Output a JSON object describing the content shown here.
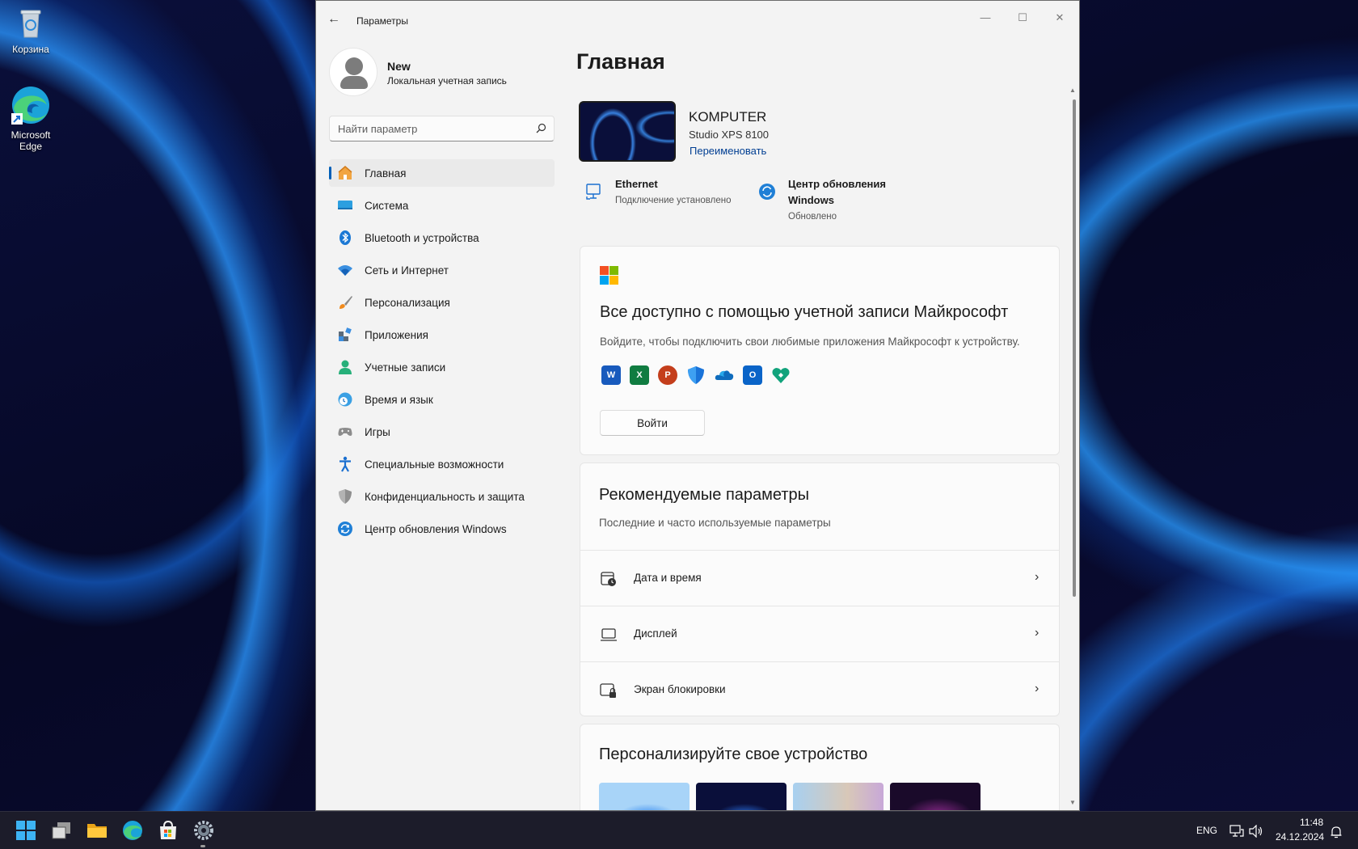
{
  "desktop": {
    "icons": [
      {
        "label": "Корзина"
      },
      {
        "label": "Microsoft Edge"
      }
    ]
  },
  "window": {
    "title": "Параметры",
    "controls": {
      "minimize": "—",
      "maximize": "☐",
      "close": "✕"
    }
  },
  "profile": {
    "name": "New",
    "account_type": "Локальная учетная запись"
  },
  "search": {
    "placeholder": "Найти параметр"
  },
  "nav": {
    "items": [
      {
        "label": "Главная",
        "icon": "home-icon",
        "active": true
      },
      {
        "label": "Система",
        "icon": "system-icon"
      },
      {
        "label": "Bluetooth и устройства",
        "icon": "bluetooth-icon"
      },
      {
        "label": "Сеть и Интернет",
        "icon": "wifi-icon"
      },
      {
        "label": "Персонализация",
        "icon": "brush-icon"
      },
      {
        "label": "Приложения",
        "icon": "apps-icon"
      },
      {
        "label": "Учетные записи",
        "icon": "accounts-icon"
      },
      {
        "label": "Время и язык",
        "icon": "time-language-icon"
      },
      {
        "label": "Игры",
        "icon": "gamepad-icon"
      },
      {
        "label": "Специальные возможности",
        "icon": "accessibility-icon"
      },
      {
        "label": "Конфиденциальность и защита",
        "icon": "shield-icon"
      },
      {
        "label": "Центр обновления Windows",
        "icon": "windows-update-icon"
      }
    ]
  },
  "main": {
    "title": "Главная",
    "pc": {
      "name": "KOMPUTER",
      "model": "Studio XPS 8100",
      "rename_label": "Переименовать"
    },
    "status": {
      "network": {
        "title": "Ethernet",
        "subtitle": "Подключение установлено"
      },
      "update": {
        "title_line1": "Центр обновления",
        "title_line2": "Windows",
        "subtitle": "Обновлено"
      }
    },
    "ms_account_card": {
      "title": "Все доступно с помощью учетной записи Майкрософт",
      "subtitle": "Войдите, чтобы подключить свои любимые приложения Майкрософт к устройству.",
      "apps": [
        {
          "name": "word-icon",
          "letter": "W",
          "color": "#185abd"
        },
        {
          "name": "excel-icon",
          "letter": "X",
          "color": "#107c41"
        },
        {
          "name": "powerpoint-icon",
          "letter": "P",
          "color": "#c43e1c"
        },
        {
          "name": "defender-icon",
          "letter": "",
          "color": "#1a73d9"
        },
        {
          "name": "onedrive-icon",
          "letter": "",
          "color": "#0f6cbd"
        },
        {
          "name": "outlook-icon",
          "letter": "O",
          "color": "#0a64c8"
        },
        {
          "name": "family-icon",
          "letter": "",
          "color": "#12a37c"
        }
      ],
      "signin_label": "Войти"
    },
    "recommended": {
      "title": "Рекомендуемые параметры",
      "subtitle": "Последние и часто используемые параметры",
      "items": [
        {
          "label": "Дата и время",
          "icon": "clock-calendar-icon"
        },
        {
          "label": "Дисплей",
          "icon": "display-icon"
        },
        {
          "label": "Экран блокировки",
          "icon": "lock-screen-icon"
        }
      ]
    },
    "personalize": {
      "title": "Персонализируйте свое устройство"
    }
  },
  "taskbar": {
    "apps": [
      "start-icon",
      "task-view-icon",
      "file-explorer-icon",
      "edge-icon",
      "store-icon",
      "settings-icon"
    ],
    "language": "ENG",
    "time": "11:48",
    "date": "24.12.2024"
  },
  "colors": {
    "accent": "#005fb8",
    "link": "#003e92",
    "window_bg": "#f3f3f3",
    "card_bg": "#fbfbfb",
    "taskbar_bg": "#1c1c2a"
  }
}
